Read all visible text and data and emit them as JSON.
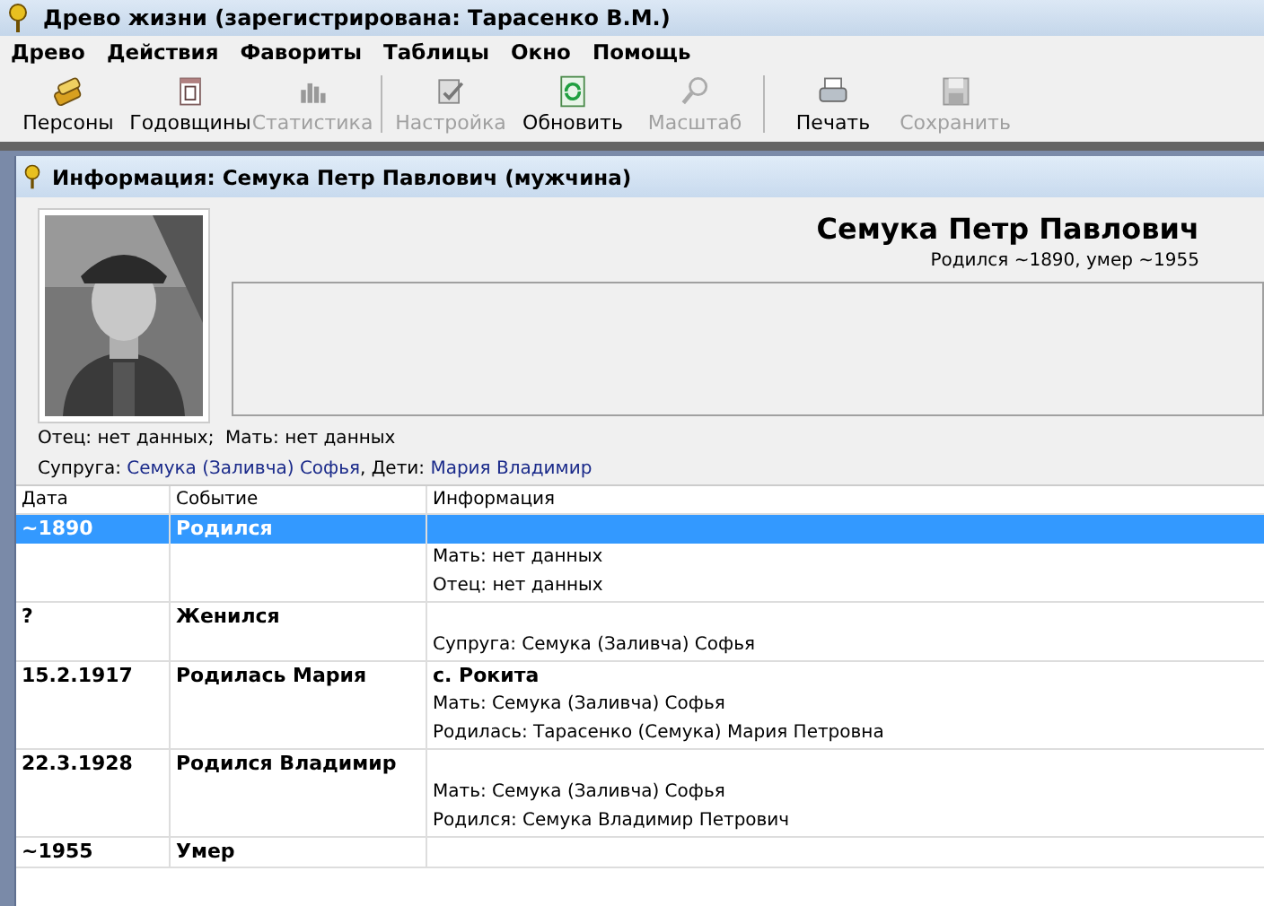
{
  "window": {
    "title": "Древо жизни (зарегистрирована: Тарасенко В.М.)"
  },
  "menu": [
    "Древо",
    "Действия",
    "Фавориты",
    "Таблицы",
    "Окно",
    "Помощь"
  ],
  "toolbar": [
    {
      "label": "Персоны",
      "disabled": false,
      "separator_after": false
    },
    {
      "label": "Годовщины",
      "disabled": false,
      "separator_after": false
    },
    {
      "label": "Статистика",
      "disabled": true,
      "separator_after": true
    },
    {
      "label": "Настройка",
      "disabled": true,
      "separator_after": false
    },
    {
      "label": "Обновить",
      "disabled": false,
      "separator_after": false
    },
    {
      "label": "Масштаб",
      "disabled": true,
      "separator_after": true
    },
    {
      "label": "Печать",
      "disabled": false,
      "separator_after": false
    },
    {
      "label": "Сохранить",
      "disabled": true,
      "separator_after": false
    }
  ],
  "info_window": {
    "title": "Информация: Семука Петр Павлович (мужчина)",
    "photo": {
      "kind": "picture"
    },
    "name": "Семука Петр Павлович",
    "lifespan": "Родился ~1890, умер ~1955",
    "parents": "Отец: нет данных;  Мать: нет данных",
    "spouse_label": "Супруга:",
    "spouse": "Семука (Заливча) Софья",
    "children_label": ", Дети:",
    "children": [
      "Мария",
      "Владимир"
    ],
    "table": {
      "columns": [
        "Дата",
        "Событие",
        "Информация"
      ],
      "rows": [
        {
          "date": "~1890",
          "event": "Родился",
          "selected": true,
          "details": [
            "Мать: нет данных",
            "Отец: нет данных"
          ]
        },
        {
          "date": "?",
          "event": "Женился",
          "selected": false,
          "details": [
            "Супруга: Семука (Заливча) Софья"
          ]
        },
        {
          "date": "15.2.1917",
          "event": "Родилась Мария",
          "selected": false,
          "place": "с. Рокита",
          "details": [
            "Мать: Семука (Заливча) Софья",
            "Родилась: Тарасенко (Семука) Мария Петровна"
          ]
        },
        {
          "date": "22.3.1928",
          "event": "Родился Владимир",
          "selected": false,
          "details": [
            "Мать: Семука (Заливча) Софья",
            "Родился: Семука Владимир Петрович"
          ]
        },
        {
          "date": "~1955",
          "event": "Умер",
          "selected": false,
          "details": []
        }
      ]
    }
  }
}
